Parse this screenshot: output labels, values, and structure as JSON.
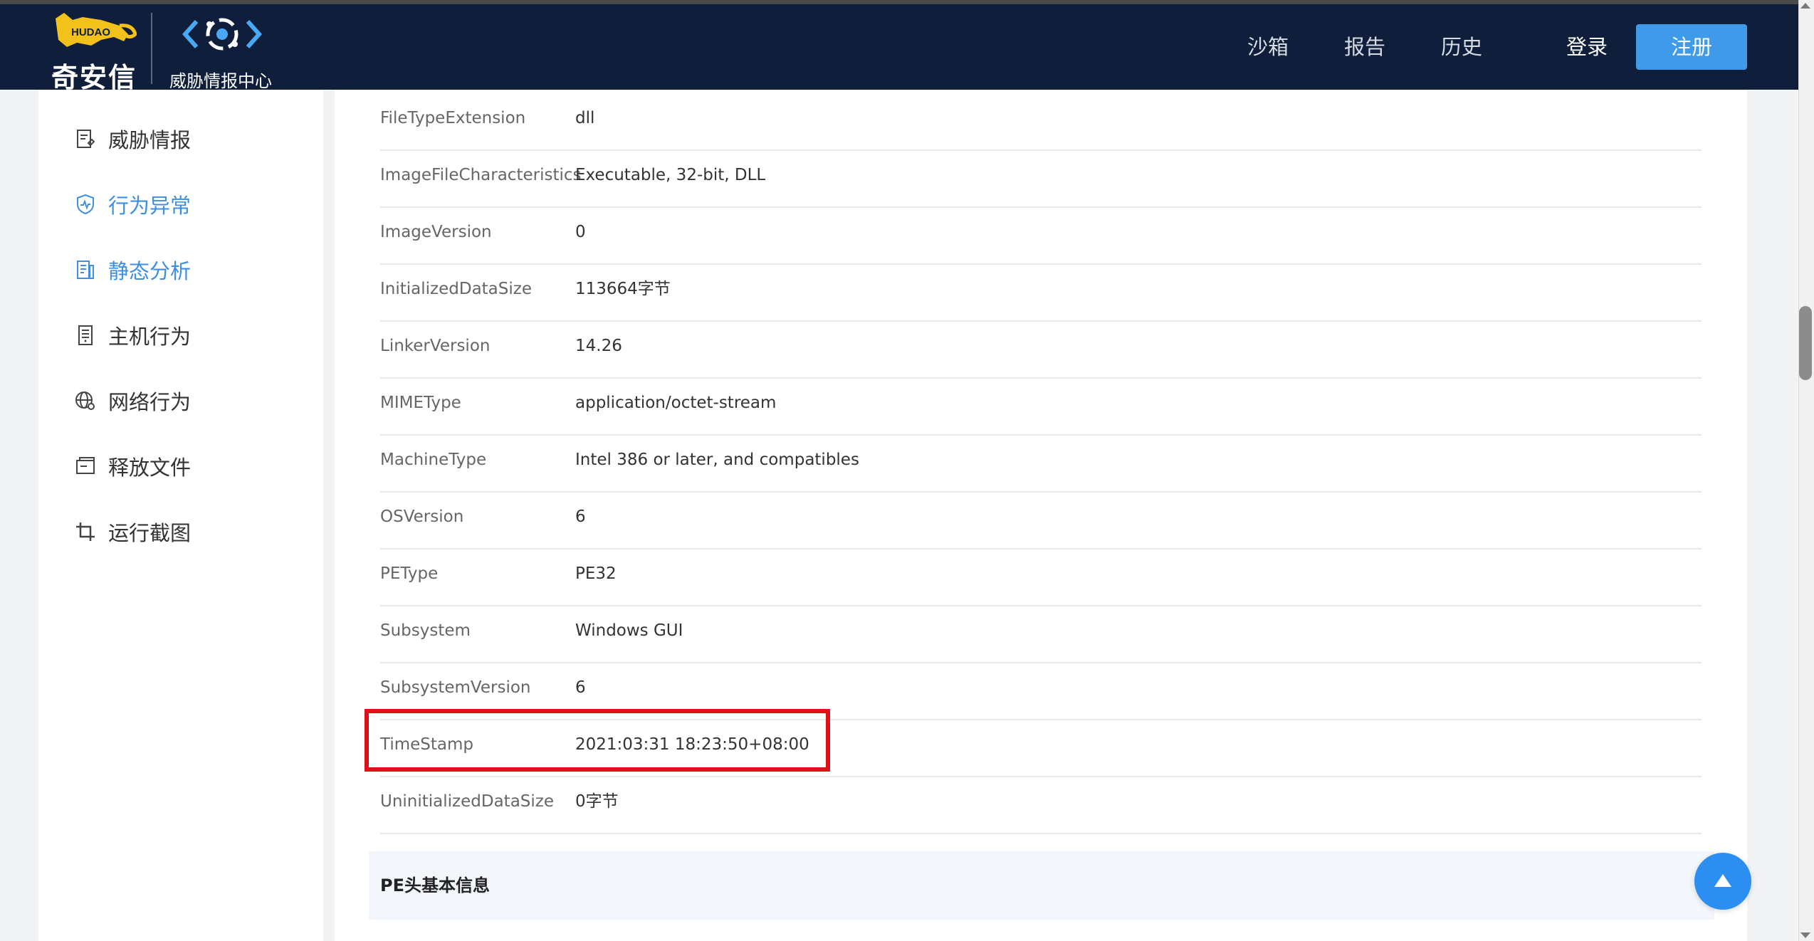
{
  "header": {
    "brand_text": "奇安信",
    "brand_mark_text": "HUDAO",
    "product_text": "威胁情报中心",
    "nav": [
      "沙箱",
      "报告",
      "历史"
    ],
    "login_label": "登录",
    "register_label": "注册",
    "colors": {
      "background": "#0f1e3a",
      "button": "#3f9bea"
    }
  },
  "sidebar": {
    "items": [
      {
        "label": "威胁情报",
        "icon": "report-icon",
        "active": false
      },
      {
        "label": "行为异常",
        "icon": "shield-icon",
        "active": true
      },
      {
        "label": "静态分析",
        "icon": "document-icon",
        "active": true
      },
      {
        "label": "主机行为",
        "icon": "host-icon",
        "active": false
      },
      {
        "label": "网络行为",
        "icon": "globe-icon",
        "active": false
      },
      {
        "label": "释放文件",
        "icon": "folder-icon",
        "active": false
      },
      {
        "label": "运行截图",
        "icon": "crop-icon",
        "active": false
      }
    ],
    "active_color": "#3f8fe0"
  },
  "details": {
    "rows": [
      {
        "key": "FileTypeExtension",
        "value": "dll"
      },
      {
        "key": "ImageFileCharacteristics",
        "value": "Executable, 32-bit, DLL"
      },
      {
        "key": "ImageVersion",
        "value": "0"
      },
      {
        "key": "InitializedDataSize",
        "value": "113664字节"
      },
      {
        "key": "LinkerVersion",
        "value": "14.26"
      },
      {
        "key": "MIMEType",
        "value": "application/octet-stream"
      },
      {
        "key": "MachineType",
        "value": "Intel 386 or later, and compatibles"
      },
      {
        "key": "OSVersion",
        "value": "6"
      },
      {
        "key": "PEType",
        "value": "PE32"
      },
      {
        "key": "Subsystem",
        "value": "Windows GUI"
      },
      {
        "key": "SubsystemVersion",
        "value": "6"
      },
      {
        "key": "TimeStamp",
        "value": "2021:03:31 18:23:50+08:00"
      },
      {
        "key": "UninitializedDataSize",
        "value": "0字节"
      }
    ],
    "highlighted_key": "TimeStamp",
    "highlight_color": "#e0101a"
  },
  "section_title": "PE头基本信息"
}
